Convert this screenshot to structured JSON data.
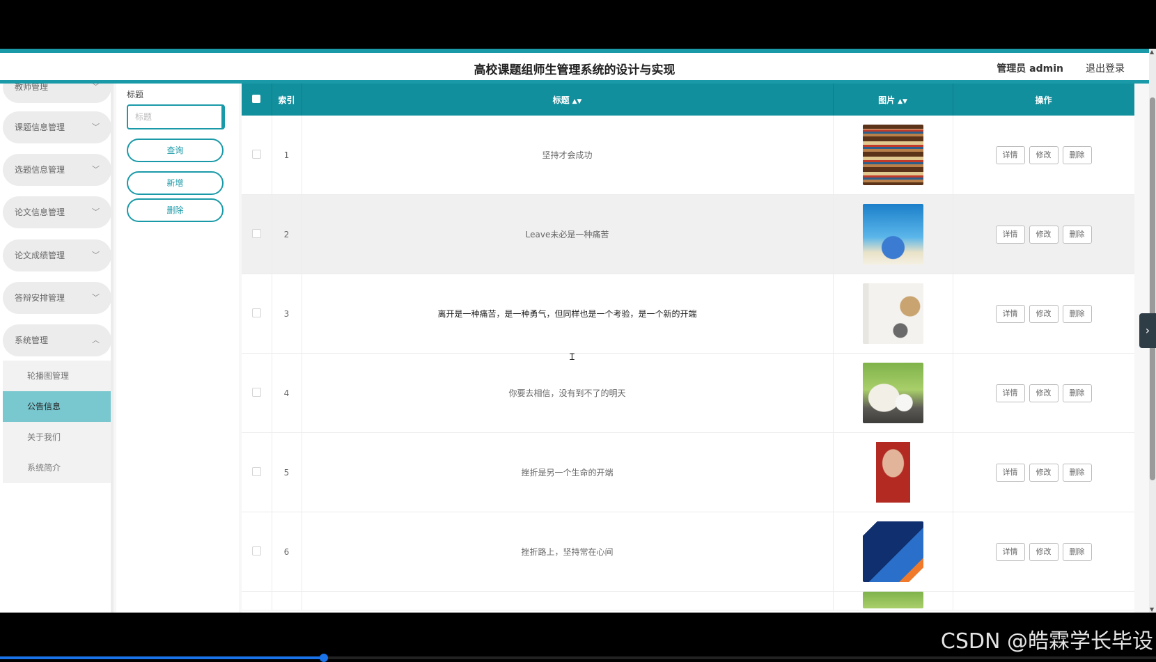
{
  "header": {
    "title": "高校课题组师生管理系统的设计与实现",
    "user": "管理员 admin",
    "logout": "退出登录"
  },
  "sidebar": {
    "items": [
      {
        "label": "教师管理",
        "icon": "chevron-down-icon"
      },
      {
        "label": "课题信息管理",
        "icon": "chevron-down-icon"
      },
      {
        "label": "选题信息管理",
        "icon": "chevron-down-icon"
      },
      {
        "label": "论文信息管理",
        "icon": "chevron-down-icon"
      },
      {
        "label": "论文成绩管理",
        "icon": "chevron-down-icon"
      },
      {
        "label": "答辩安排管理",
        "icon": "chevron-down-icon"
      },
      {
        "label": "系统管理",
        "icon": "chevron-up-icon"
      }
    ],
    "submenu": [
      {
        "label": "轮播图管理"
      },
      {
        "label": "公告信息",
        "active": true
      },
      {
        "label": "关于我们"
      },
      {
        "label": "系统简介"
      }
    ]
  },
  "search": {
    "label": "标题",
    "placeholder": "标题",
    "query_button": "查询",
    "add_button": "新增",
    "delete_button": "删除"
  },
  "table": {
    "headers": {
      "index": "索引",
      "title": "标题",
      "image": "图片",
      "actions": "操作"
    },
    "actions": {
      "detail": "详情",
      "edit": "修改",
      "delete": "删除"
    },
    "rows": [
      {
        "index": "1",
        "title": "坚持才会成功",
        "image": "bookshelf"
      },
      {
        "index": "2",
        "title": "Leave未必是一种痛苦",
        "image": "book-cover-globe"
      },
      {
        "index": "3",
        "title": "离开是一种痛苦，是一种勇气，但同样也是一个考验，是一个新的开端",
        "image": "book-cover-portrait"
      },
      {
        "index": "4",
        "title": "你要去相信，没有到不了的明天",
        "image": "open-book-lightbulb"
      },
      {
        "index": "5",
        "title": "挫折是另一个生命的开端",
        "image": "book-cover-man"
      },
      {
        "index": "6",
        "title": "挫折路上，坚持常在心间",
        "image": "ocean-book"
      }
    ]
  },
  "watermark": "CSDN @皓霖学长毕设",
  "video_progress": 0.28,
  "colors": {
    "accent": "#1a9aa8",
    "table_header": "#128f9d",
    "active_menu": "#79c7cf"
  }
}
